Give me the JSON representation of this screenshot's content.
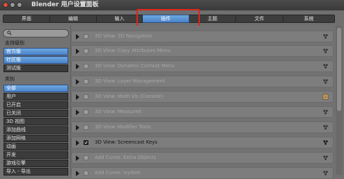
{
  "window": {
    "title": "Blender 用户设置面板"
  },
  "tabs": [
    {
      "label": "界面",
      "active": false
    },
    {
      "label": "编辑",
      "active": false
    },
    {
      "label": "输入",
      "active": false
    },
    {
      "label": "插件",
      "active": true
    },
    {
      "label": "主题",
      "active": false
    },
    {
      "label": "文件",
      "active": false
    },
    {
      "label": "系统",
      "active": false
    }
  ],
  "sidebar": {
    "search_placeholder": "",
    "support_label": "支持级别",
    "support_levels": [
      {
        "label": "官方版",
        "selected": true
      },
      {
        "label": "社区版",
        "selected": true
      },
      {
        "label": "测试版",
        "selected": false
      }
    ],
    "category_label": "类别",
    "categories": [
      {
        "label": "全部",
        "selected": true
      },
      {
        "label": "用户",
        "selected": false
      },
      {
        "label": "已开启",
        "selected": false
      },
      {
        "label": "已关闭",
        "selected": false
      },
      {
        "label": "3D 视图",
        "selected": false
      },
      {
        "label": "添加曲线",
        "selected": false
      },
      {
        "label": "添加网格",
        "selected": false
      },
      {
        "label": "动画",
        "selected": false
      },
      {
        "label": "开发",
        "selected": false
      },
      {
        "label": "游戏引擎",
        "selected": false
      },
      {
        "label": "导入 - 导出",
        "selected": false
      }
    ]
  },
  "addons": [
    {
      "name": "3D View: 3D Navigation",
      "enabled": false,
      "icon": "community-icon"
    },
    {
      "name": "3D View: Copy Attributes Menu",
      "enabled": false,
      "icon": "community-icon"
    },
    {
      "name": "3D View: Dynamic Context Menu",
      "enabled": false,
      "icon": "community-icon"
    },
    {
      "name": "3D View: Layer Management",
      "enabled": false,
      "icon": "community-icon"
    },
    {
      "name": "3D View: Math Vis (Console)",
      "enabled": false,
      "icon": "official-icon"
    },
    {
      "name": "3D View: Measureit",
      "enabled": false,
      "icon": "community-icon"
    },
    {
      "name": "3D View: Modifier Tools",
      "enabled": false,
      "icon": "community-icon"
    },
    {
      "name": "3D View: Screencast Keys",
      "enabled": true,
      "icon": "community-icon"
    },
    {
      "name": "Add Curve: Extra Objects",
      "enabled": false,
      "icon": "community-icon"
    },
    {
      "name": "Add Curve: IvyGen",
      "enabled": false,
      "icon": "community-icon"
    }
  ]
}
